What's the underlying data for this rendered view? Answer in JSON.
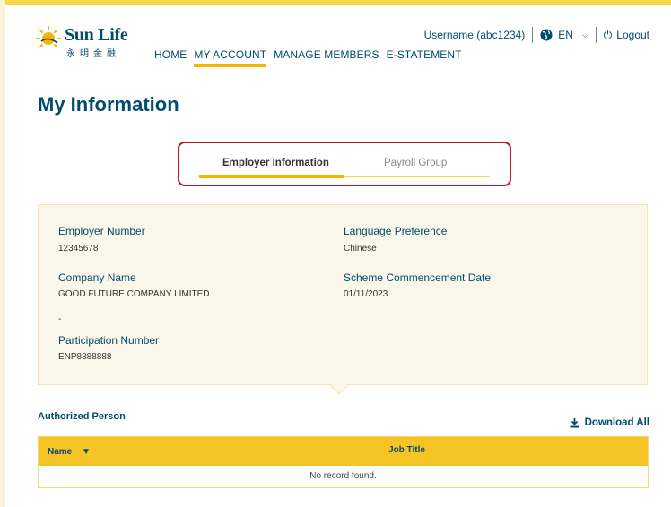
{
  "brand": {
    "name": "Sun Life",
    "chinese_name": "永明金融",
    "color": "#004c6c",
    "accent": "#f6b500"
  },
  "nav": {
    "items": [
      "HOME",
      "MY ACCOUNT",
      "MANAGE MEMBERS",
      "E-STATEMENT"
    ],
    "active_index": 1
  },
  "userbar": {
    "username": "Username (abc1234)",
    "language": "EN",
    "logout": "Logout",
    "globe_icon": "globe-icon",
    "logout_icon": "power-icon"
  },
  "page": {
    "title": "My Information"
  },
  "tabs": [
    {
      "label": "Employer Information",
      "active": true
    },
    {
      "label": "Payroll Group",
      "active": false
    }
  ],
  "info": {
    "employer_number_label": "Employer Number",
    "employer_number": "12345678",
    "language_pref_label": "Language Preference",
    "language_pref": "Chinese",
    "company_name_label": "Company Name",
    "company_name": "GOOD FUTURE COMPANY LIMITED",
    "scheme_date_label": "Scheme Commencement Date",
    "scheme_date": "01/11/2023",
    "dash": "-",
    "participation_label": "Participation Number",
    "participation_number": "ENP8888888"
  },
  "authorized": {
    "title": "Authorized Person",
    "download_label": "Download All",
    "download_icon": "download-icon",
    "columns": [
      "Name",
      "Job Title"
    ],
    "empty_text": "No record found."
  }
}
